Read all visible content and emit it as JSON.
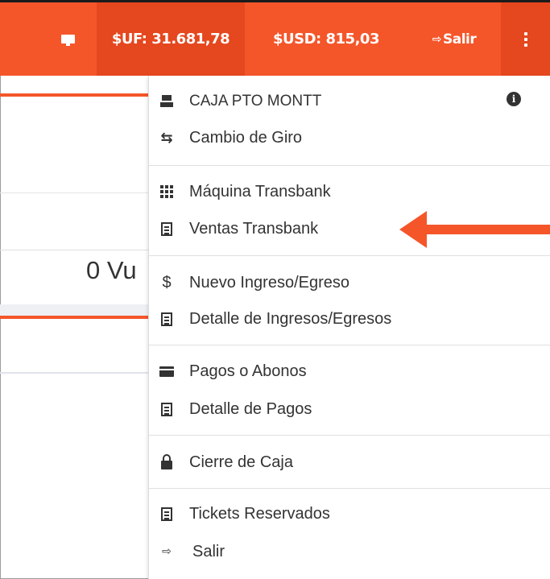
{
  "topbar": {
    "uf_label": "$UF: 31.681,78",
    "usd_label": "$USD: 815,03",
    "salir_label": "Salir",
    "exit_icon_glyph": "⇨"
  },
  "background": {
    "big_text": "0 Vu"
  },
  "menu": {
    "caja": "CAJA PTO MONTT",
    "cambio_giro": "Cambio de Giro",
    "maquina_transbank": "Máquina Transbank",
    "ventas_transbank": "Ventas Transbank",
    "nuevo_ingreso": "Nuevo Ingreso/Egreso",
    "detalle_ingresos": "Detalle de Ingresos/Egresos",
    "pagos_abonos": "Pagos o Abonos",
    "detalle_pagos": "Detalle de Pagos",
    "cierre_caja": "Cierre de Caja",
    "tickets_reservados": "Tickets Reservados",
    "salir": "Salir",
    "exchange_glyph": "⇆",
    "dollar_glyph": "$",
    "exit_glyph": "⇨",
    "info_glyph": "i"
  },
  "colors": {
    "accent": "#f4562a",
    "accent_dark": "#e5471e",
    "text": "#333333"
  }
}
